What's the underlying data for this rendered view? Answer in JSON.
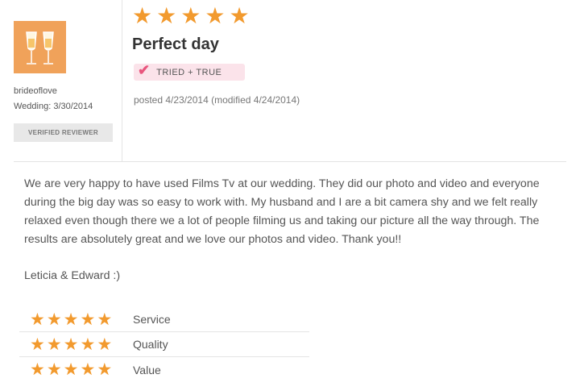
{
  "review": {
    "reviewer": {
      "username": "brideoflove",
      "wedding_date": "Wedding: 3/30/2014",
      "verified_label": "VERIFIED REVIEWER"
    },
    "overall_rating": 5,
    "title": "Perfect day",
    "badge_label": "TRIED + TRUE",
    "posted": "posted 4/23/2014 (modified 4/24/2014)",
    "body": "We are very happy to have used Films Tv at our wedding. They did our photo and video and everyone during the big day was so easy to work with. My husband and I are a bit camera shy and we felt really relaxed even though there we a lot of people filming us and taking our picture all the way through. The results are absolutely great and we love our photos and video. Thank you!!",
    "signature": "Leticia & Edward :)",
    "ratings": [
      {
        "label": "Service",
        "stars": 5
      },
      {
        "label": "Quality",
        "stars": 5
      },
      {
        "label": "Value",
        "stars": 5
      }
    ]
  },
  "colors": {
    "star": "#f29a2e",
    "badge_bg": "#fbe3ea",
    "badge_check": "#e8557d",
    "avatar_bg": "#f0a25a"
  },
  "icons": {
    "star": "star-icon",
    "avatar": "champagne-glasses-icon",
    "badge": "checkmark-icon"
  }
}
